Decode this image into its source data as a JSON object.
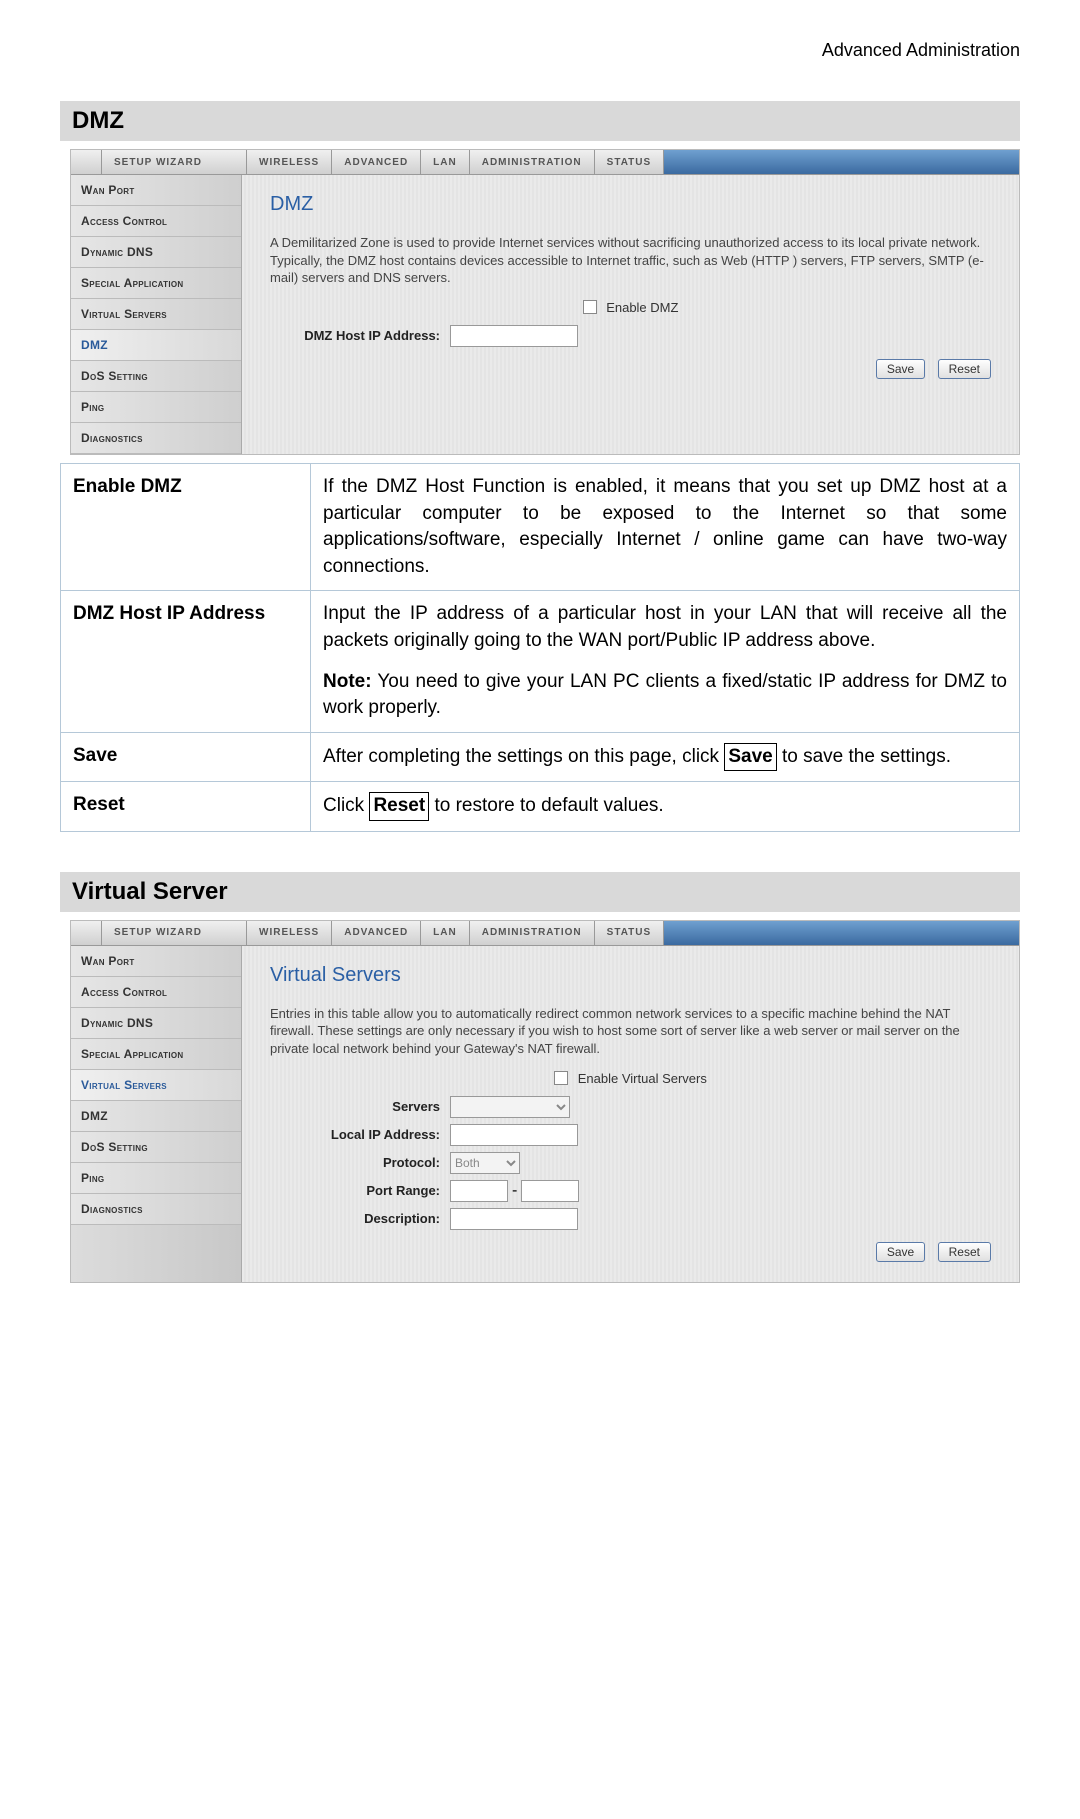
{
  "page_header": "Advanced Administration",
  "section1_title": "DMZ",
  "section2_title": "Virtual Server",
  "tabs": {
    "t0": "Setup Wizard",
    "t1": "Wireless",
    "t2": "Advanced",
    "t3": "LAN",
    "t4": "Administration",
    "t5": "Status"
  },
  "sidebar": {
    "s0": "Wan Port",
    "s1": "Access Control",
    "s2": "Dynamic DNS",
    "s3": "Special Application",
    "s4": "Virtual Servers",
    "s5": "DMZ",
    "s6": "DoS Setting",
    "s7": "Ping",
    "s8": "Diagnostics"
  },
  "dmz_panel": {
    "title": "DMZ",
    "desc": "A Demilitarized Zone is used to provide Internet services without sacrificing unauthorized access to its local private network. Typically, the DMZ host contains devices accessible to Internet traffic, such as Web (HTTP ) servers, FTP servers, SMTP (e-mail) servers and DNS servers.",
    "enable_label": "Enable DMZ",
    "ip_label": "DMZ Host IP Address:",
    "save": "Save",
    "reset": "Reset"
  },
  "vs_panel": {
    "title": "Virtual Servers",
    "desc": "Entries in this table allow you to automatically redirect common network services to a specific machine behind the NAT firewall. These settings are only necessary if you wish to host some sort of server like a web server or mail server on the private local network behind your Gateway's NAT firewall.",
    "enable_label": "Enable Virtual Servers",
    "servers_label": "Servers",
    "localip_label": "Local IP Address:",
    "protocol_label": "Protocol:",
    "protocol_value": "Both",
    "portrange_label": "Port Range:",
    "portrange_sep": "-",
    "description_label": "Description:",
    "save": "Save",
    "reset": "Reset"
  },
  "desc_table": {
    "r0k": "Enable DMZ",
    "r0v": "If the DMZ Host Function is enabled, it means that you set up DMZ host at a particular computer to be exposed to the Internet so that some applications/software, especially Internet / online game can have two-way connections.",
    "r1k": "DMZ Host IP Address",
    "r1v_p1": "Input the IP address of a particular host in your LAN that will receive all the packets originally going to the WAN port/Public IP address above.",
    "r1v_note_label": "Note:",
    "r1v_note": " You need to give your LAN PC clients a fixed/static IP address for DMZ to work properly.",
    "r2k": "Save",
    "r2v_a": "After completing the settings on this page, click ",
    "r2v_b": "Save",
    "r2v_c": " to save the settings.",
    "r3k": "Reset",
    "r3v_a": "Click ",
    "r3v_b": "Reset",
    "r3v_c": " to restore to default values."
  }
}
